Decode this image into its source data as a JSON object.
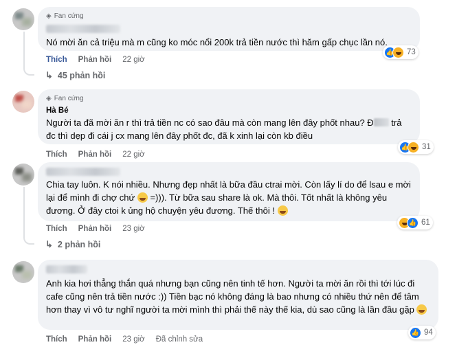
{
  "comments": [
    {
      "badge": "Fan cứng",
      "name": "",
      "text": "Nó mời ăn cả triệu mà m cũng ko móc nổi 200k trả tiền nước thì hăm gấp chục lần nó.",
      "actions": {
        "like": "Thích",
        "reply": "Phản hồi",
        "time": "22 giờ"
      },
      "reactions": {
        "icons": [
          "like-icon",
          "haha-icon"
        ],
        "count": "73"
      },
      "replies_label": "45 phản hồi"
    },
    {
      "badge": "Fan cứng",
      "name": "Hà Bé",
      "text_parts": [
        "Người ta đã mời ăn r thì trả tiền nc có sao đâu mà còn mang lên đây phốt nhau? Đ",
        " trả đc thì dẹp đi cái j cx mang lên đây phốt đc, đã k xinh lại còn kb điều"
      ],
      "actions": {
        "like": "Thích",
        "reply": "Phản hồi",
        "time": "22 giờ"
      },
      "reactions": {
        "icons": [
          "like-icon",
          "haha-icon"
        ],
        "count": "31"
      }
    },
    {
      "name": "",
      "text_parts": [
        "Chia tay luôn. K nói nhiều. Nhưng đẹp nhất là bữa đầu ctrai mời. Còn lấy lí do để lsau e mời lại để mình đi chợ chứ ",
        " =))). Từ bữa sau share là ok. Mà thôi. Tốt nhất là không yêu đương. Ở đây ctoi k ủng hộ chuyện yêu đương. Thế thôi ! "
      ],
      "actions": {
        "like": "Thích",
        "reply": "Phản hồi",
        "time": "23 giờ"
      },
      "reactions": {
        "icons": [
          "haha-icon",
          "like-icon"
        ],
        "count": "61"
      },
      "replies_label": "2 phản hồi"
    },
    {
      "name": "",
      "text": "Anh kia hơi thẳng thắn quá nhưng bạn cũng nên tinh tế hơn. Người ta mời ăn rồi thì tới lúc đi cafe cũng nên trả tiền nước :)) Tiền bạc nó không đáng là bao nhưng có nhiều thứ nên để tâm hơn thay vì vô tư nghĩ người ta mời mình thì phải thế này thế kia, dù sao cũng là lần đầu gặp ",
      "actions": {
        "like": "Thích",
        "reply": "Phản hồi",
        "time": "23 giờ",
        "edited": "Đã chỉnh sửa"
      },
      "reactions": {
        "icons": [
          "like-icon"
        ],
        "count": "94"
      }
    }
  ],
  "colors": {
    "like": "#1877f2",
    "haha": "#f7b125",
    "bubble": "#f0f2f5",
    "meta": "#65676b"
  }
}
